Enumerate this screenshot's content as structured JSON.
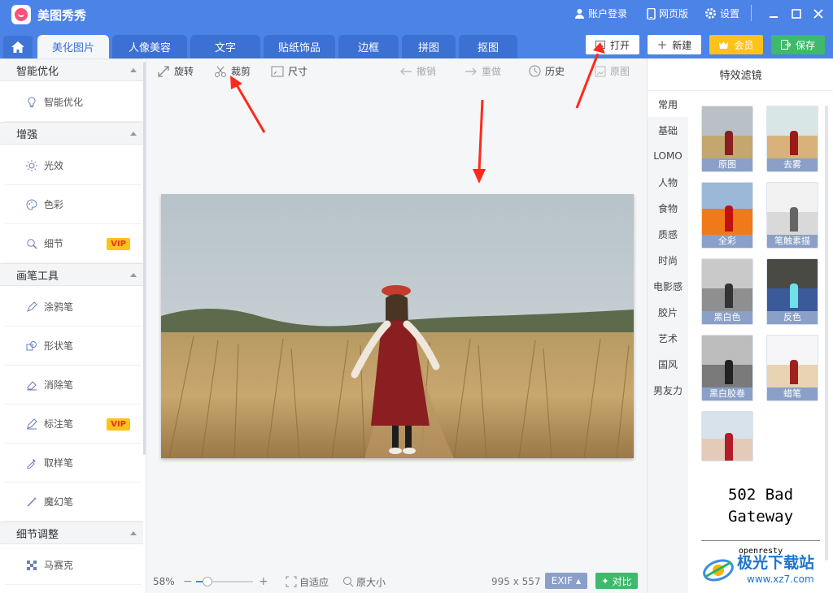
{
  "app": {
    "title": "美图秀秀"
  },
  "titlebar": {
    "login": "账户登录",
    "web": "网页版",
    "settings": "设置"
  },
  "tabs": [
    "美化图片",
    "人像美容",
    "文字",
    "贴纸饰品",
    "边框",
    "拼图",
    "抠图"
  ],
  "top_buttons": {
    "open": "打开",
    "new": "新建",
    "vip": "会员",
    "save": "保存"
  },
  "sidebar": {
    "sections": [
      {
        "title": "智能优化",
        "items": [
          {
            "label": "智能优化"
          }
        ]
      },
      {
        "title": "增强",
        "items": [
          {
            "label": "光效"
          },
          {
            "label": "色彩"
          },
          {
            "label": "细节",
            "badge": "VIP"
          }
        ]
      },
      {
        "title": "画笔工具",
        "items": [
          {
            "label": "涂鸦笔"
          },
          {
            "label": "形状笔"
          },
          {
            "label": "消除笔"
          },
          {
            "label": "标注笔",
            "badge": "VIP"
          },
          {
            "label": "取样笔"
          },
          {
            "label": "魔幻笔"
          }
        ]
      },
      {
        "title": "细节调整",
        "items": [
          {
            "label": "马赛克"
          }
        ]
      }
    ]
  },
  "toolbar": {
    "rotate": "旋转",
    "crop": "裁剪",
    "size": "尺寸",
    "undo": "撤销",
    "redo": "重做",
    "history": "历史",
    "original": "原图"
  },
  "bottombar": {
    "zoom": "58%",
    "fit": "自适应",
    "actual": "原大小",
    "dims": "995 x 557",
    "exif": "EXIF",
    "compare": "对比"
  },
  "right_panel": {
    "title": "特效滤镜",
    "categories": [
      "常用",
      "基础",
      "LOMO",
      "人物",
      "食物",
      "质感",
      "时尚",
      "电影感",
      "胶片",
      "艺术",
      "国风",
      "男友力"
    ],
    "filters": [
      "原图",
      "去雾",
      "全彩",
      "笔触素描",
      "黑白色",
      "反色",
      "黑白胶卷",
      "蜡笔",
      ""
    ]
  },
  "error": {
    "line1": "502 Bad",
    "line2": "Gateway",
    "server": "openresty"
  },
  "watermark": {
    "brand": "极光下载站",
    "url": "www.xz7.com"
  },
  "colors": {
    "brand": "#4b83e7",
    "vip": "#ffc21a",
    "save": "#3fb96b"
  }
}
